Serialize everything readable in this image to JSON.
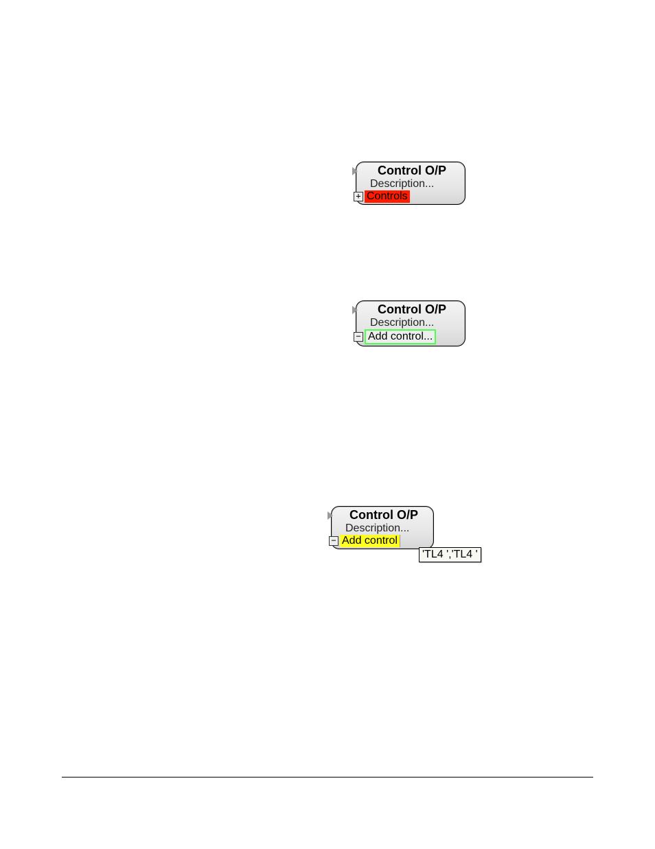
{
  "block1": {
    "title": "Control O/P",
    "desc": "Description...",
    "toggle": "+",
    "controls_label": "Controls"
  },
  "block2": {
    "title": "Control O/P",
    "desc": "Description...",
    "toggle": "−",
    "addcontrol_label": "Add control..."
  },
  "block3": {
    "title": "Control O/P",
    "desc": "Description...",
    "toggle": "−",
    "addcontrol_label": "Add control",
    "tooltip": "'TL4 ','TL4 '"
  }
}
